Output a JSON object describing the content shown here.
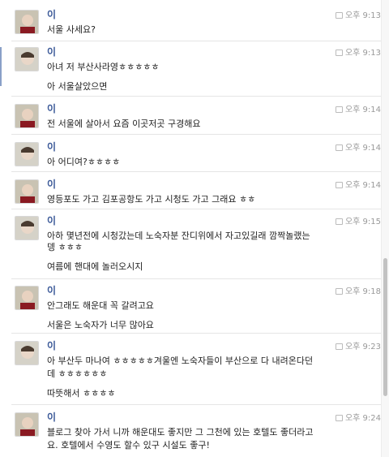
{
  "messages": [
    {
      "name": "이",
      "time": "오후 9:13",
      "lines": [
        "서울 사세요?"
      ]
    },
    {
      "name": "이",
      "time": "오후 9:13",
      "lines": [
        "아녀 저 부산사라영ㅎㅎㅎㅎㅎ",
        "아 서울살았으면"
      ]
    },
    {
      "name": "이",
      "time": "오후 9:14",
      "lines": [
        "전 서울에 살아서 요즘 이곳저곳 구경해요"
      ]
    },
    {
      "name": "이",
      "time": "오후 9:14",
      "lines": [
        "아 어디여?ㅎㅎㅎㅎ"
      ]
    },
    {
      "name": "이",
      "time": "오후 9:14",
      "lines": [
        "영등포도 가고 김포공항도 가고 시청도 가고 그래요 ㅎㅎ"
      ]
    },
    {
      "name": "이",
      "time": "오후 9:15",
      "lines": [
        "아하 몇년전에 시청갔는데 노숙자분 잔디위에서 자고있길래 깜짝놀랬는",
        "뎅 ㅎㅎㅎ",
        "여름에 핸대에 놀러오시지"
      ]
    },
    {
      "name": "이",
      "time": "오후 9:18",
      "lines": [
        "안그래도 해운대 꼭 갈려고요",
        "서울은 노숙자가 너무 많아요"
      ]
    },
    {
      "name": "이",
      "time": "오후 9:23",
      "lines": [
        "아 부산두 마나여 ㅎㅎㅎㅎㅎ겨울엔 노숙자들이 부산으로 다 내려온다던",
        "데 ㅎㅎㅎㅎㅎㅎ",
        "따뜻해서 ㅎㅎㅎㅎ"
      ]
    },
    {
      "name": "이",
      "time": "오후 9:24",
      "lines": [
        "블로그 찾아 가서 니까 해운대도 좋지만 그 그천에 있는 호텔도 좋더라고",
        "요. 호텔에서 수영도 할수 있구 시설도 좋구!"
      ]
    }
  ],
  "icons": {
    "avatar": "avatar-photo-icon",
    "status": "checkbox-icon"
  }
}
